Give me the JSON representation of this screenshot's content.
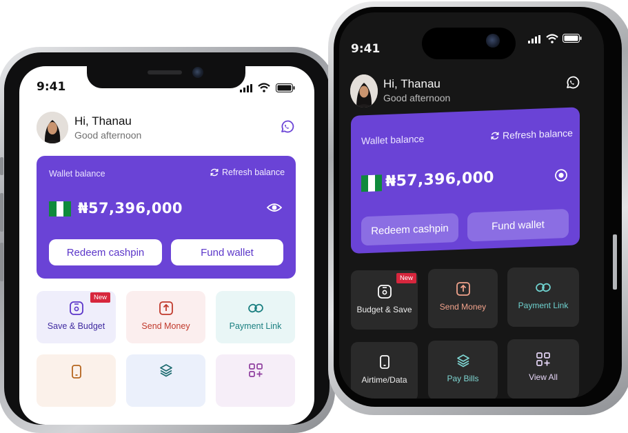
{
  "status_time": "9:41",
  "greeting": {
    "name": "Hi, Thanau",
    "subtitle": "Good afternoon"
  },
  "wallet": {
    "label": "Wallet balance",
    "refresh_label": "Refresh balance",
    "amount": "₦57,396,000",
    "redeem_label": "Redeem cashpin",
    "fund_label": "Fund wallet"
  },
  "light_tiles": [
    {
      "label": "Save & Budget",
      "badge": "New"
    },
    {
      "label": "Send Money"
    },
    {
      "label": "Payment Link"
    }
  ],
  "dark_tiles": [
    {
      "label": "Budget & Save",
      "badge": "New"
    },
    {
      "label": "Send Money"
    },
    {
      "label": "Payment Link"
    },
    {
      "label": "Airtime/Data"
    },
    {
      "label": "Pay Bills"
    },
    {
      "label": "View All"
    }
  ],
  "colors": {
    "brand_purple": "#6a43d6",
    "send_red": "#c0392b",
    "link_teal": "#1a7f80",
    "flag_green": "#0f8a3c"
  },
  "icons": [
    "whatsapp-icon",
    "refresh-icon",
    "eye-icon",
    "wallet-icon",
    "upload-icon",
    "link-icon",
    "phone-icon",
    "layers-icon",
    "grid-plus-icon",
    "signal-icon",
    "wifi-icon",
    "battery-icon"
  ]
}
